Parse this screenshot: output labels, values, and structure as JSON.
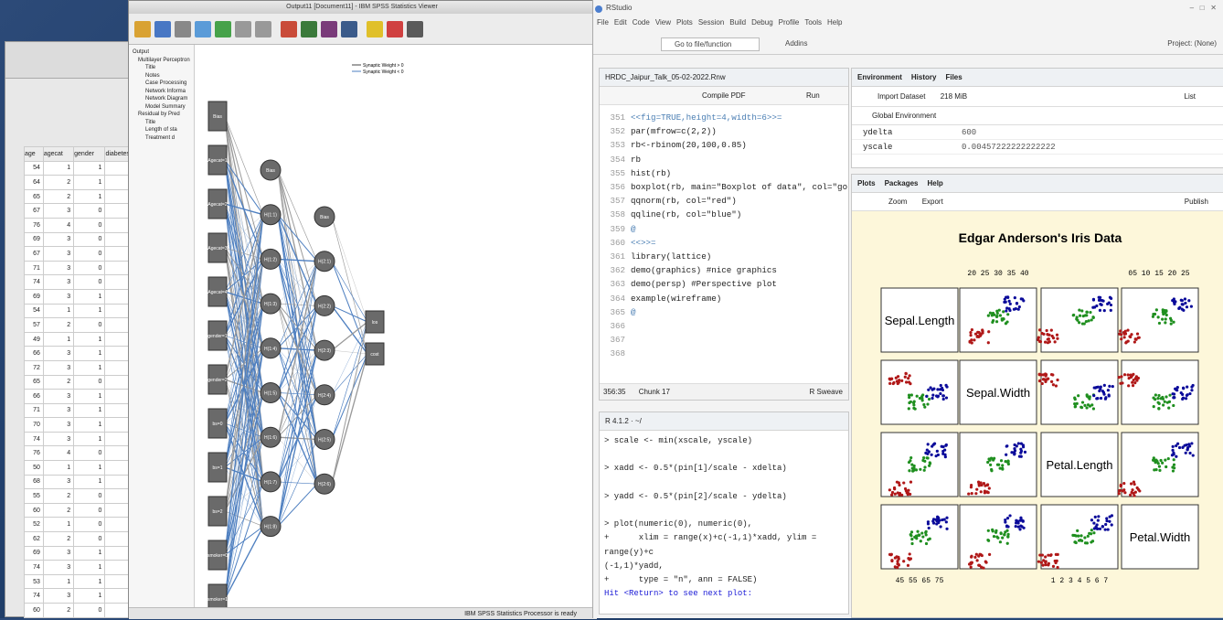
{
  "spss_data": {
    "headers": [
      "age",
      "agecat",
      "gender",
      "diabetes"
    ],
    "rows": [
      [
        "54",
        "1",
        "1",
        "0"
      ],
      [
        "64",
        "2",
        "1",
        "0"
      ],
      [
        "65",
        "2",
        "1",
        "0"
      ],
      [
        "67",
        "3",
        "0",
        "0"
      ],
      [
        "76",
        "4",
        "0",
        "0"
      ],
      [
        "69",
        "3",
        "0",
        "0"
      ],
      [
        "67",
        "3",
        "0",
        "1"
      ],
      [
        "71",
        "3",
        "0",
        "0"
      ],
      [
        "74",
        "3",
        "0",
        "0"
      ],
      [
        "69",
        "3",
        "1",
        "0"
      ],
      [
        "54",
        "1",
        "1",
        "0"
      ],
      [
        "57",
        "2",
        "0",
        "0"
      ],
      [
        "49",
        "1",
        "1",
        "0"
      ],
      [
        "66",
        "3",
        "1",
        "0"
      ],
      [
        "72",
        "3",
        "1",
        "0"
      ],
      [
        "65",
        "2",
        "0",
        "0"
      ],
      [
        "66",
        "3",
        "1",
        "1"
      ],
      [
        "71",
        "3",
        "1",
        "0"
      ],
      [
        "70",
        "3",
        "1",
        "0"
      ],
      [
        "74",
        "3",
        "1",
        "0"
      ],
      [
        "76",
        "4",
        "0",
        "0"
      ],
      [
        "50",
        "1",
        "1",
        "0"
      ],
      [
        "68",
        "3",
        "1",
        "0"
      ],
      [
        "55",
        "2",
        "0",
        "0"
      ],
      [
        "60",
        "2",
        "0",
        "0"
      ],
      [
        "52",
        "1",
        "0",
        "0"
      ],
      [
        "62",
        "2",
        "0",
        "0"
      ],
      [
        "69",
        "3",
        "1",
        "0"
      ],
      [
        "74",
        "3",
        "1",
        "0"
      ],
      [
        "53",
        "1",
        "1",
        "0"
      ],
      [
        "74",
        "3",
        "1",
        "0"
      ],
      [
        "60",
        "2",
        "0",
        "0"
      ]
    ]
  },
  "spss_viewer": {
    "title": "Output11 [Document11] - IBM SPSS Statistics Viewer",
    "outline": [
      "Output",
      "Multilayer Perceptron",
      "Title",
      "Notes",
      "Case Processing",
      "Network Informa",
      "Network Diagram",
      "Model Summary",
      "Residual by Pred",
      "Title",
      "Length of sta",
      "Treatment d"
    ],
    "legend": [
      "Synaptic Weight > 0",
      "Synaptic Weight < 0"
    ],
    "input_nodes": [
      "Bias",
      "Agecat=1",
      "Agecat=2",
      "Agecat=3",
      "Agecat=4",
      "gender=1",
      "gender=2",
      "bs=0",
      "bs=1",
      "bs=2",
      "smoker=0",
      "smoker=1"
    ],
    "hidden1_nodes": [
      "Bias",
      "H(1:1)",
      "H(1:2)",
      "H(1:3)",
      "H(1:4)",
      "H(1:5)",
      "H(1:6)",
      "H(1:7)",
      "H(1:8)"
    ],
    "hidden2_nodes": [
      "Bias",
      "H(2:1)",
      "H(2:2)",
      "H(2:3)",
      "H(2:4)",
      "H(2:5)",
      "H(2:6)"
    ],
    "output_nodes": [
      "los",
      "cost"
    ],
    "status": "IBM SPSS Statistics Processor is ready"
  },
  "rstudio": {
    "app_title": "RStudio",
    "menu": [
      "File",
      "Edit",
      "Code",
      "View",
      "Plots",
      "Session",
      "Build",
      "Debug",
      "Profile",
      "Tools",
      "Help"
    ],
    "goto": "Go to file/function",
    "addins": "Addins",
    "project": "Project: (None)",
    "editor_tab": "HRDC_Jaipur_Talk_05-02-2022.Rnw",
    "compile": "Compile PDF",
    "run": "Run",
    "code_lines": [
      {
        "n": "351",
        "html": "<<fig=TRUE,height=4,width=6>>="
      },
      {
        "n": "352",
        "html": "par(mfrow=c(2,2))"
      },
      {
        "n": "353",
        "html": "rb<-rbinom(20,100,0.85)"
      },
      {
        "n": "354",
        "html": "rb"
      },
      {
        "n": "355",
        "html": "hist(rb)"
      },
      {
        "n": "356",
        "html": "boxplot(rb, main=\"Boxplot of data\", col=\"gold\")"
      },
      {
        "n": "357",
        "html": "qqnorm(rb, col=\"red\")"
      },
      {
        "n": "358",
        "html": "qqline(rb, col=\"blue\")"
      },
      {
        "n": "359",
        "html": "@"
      },
      {
        "n": "360",
        "html": "<<>>="
      },
      {
        "n": "361",
        "html": "library(lattice)"
      },
      {
        "n": "362",
        "html": "demo(graphics) #nice graphics"
      },
      {
        "n": "363",
        "html": "demo(persp) #Perspective plot"
      },
      {
        "n": "364",
        "html": "example(wireframe)"
      },
      {
        "n": "365",
        "html": "@"
      },
      {
        "n": "366",
        "html": ""
      },
      {
        "n": "367",
        "html": ""
      },
      {
        "n": "368",
        "html": ""
      }
    ],
    "editor_status_left": "356:35",
    "editor_status_chunk": "Chunk 17",
    "editor_status_right": "R Sweave",
    "console_title": "R 4.1.2 · ~/",
    "console_lines": [
      "> scale <- min(xscale, yscale)",
      "",
      "> xadd <- 0.5*(pin[1]/scale - xdelta)",
      "",
      "> yadd <- 0.5*(pin[2]/scale - ydelta)",
      "",
      "> plot(numeric(0), numeric(0),",
      "+      xlim = range(x)+c(-1,1)*xadd, ylim = range(y)+c",
      "(-1,1)*yadd,",
      "+      type = \"n\", ann = FALSE)",
      "Hit <Return> to see next plot: "
    ],
    "env_tabs": [
      "Environment",
      "History",
      "Files"
    ],
    "import": "Import Dataset",
    "mem": "218 MiB",
    "list": "List",
    "global": "Global Environment",
    "env_rows": [
      [
        "ydelta",
        "600"
      ],
      [
        "yscale",
        "0.00457222222222222"
      ]
    ],
    "plot_tabs": [
      "Plots",
      "Packages",
      "Help"
    ],
    "zoom": "Zoom",
    "export": "Export",
    "publish": "Publish",
    "plot_title": "Edgar Anderson's Iris Data",
    "diag_labels": [
      "Sepal.Length",
      "Sepal.Width",
      "Petal.Length",
      "Petal.Width"
    ],
    "top_ticks_a": "20  25  30  35  40",
    "top_ticks_b": "05  10  15  20  25",
    "bottom_ticks_a": "45  55  65  75",
    "bottom_ticks_b": "1  2  3  4  5  6  7",
    "left_ticks_a": [
      "40",
      "35",
      "30",
      "25",
      "20"
    ],
    "left_ticks_b": [
      "25",
      "15",
      "05"
    ],
    "right_ticks_a": [
      "75",
      "65",
      "55",
      "45"
    ],
    "right_ticks_b": [
      "7",
      "5",
      "3",
      "1"
    ]
  },
  "colors": {
    "setosa": "#b01818",
    "versicolor": "#1f8f1f",
    "virginica": "#0b0b9a",
    "plot_bg": "#fdf7da"
  }
}
